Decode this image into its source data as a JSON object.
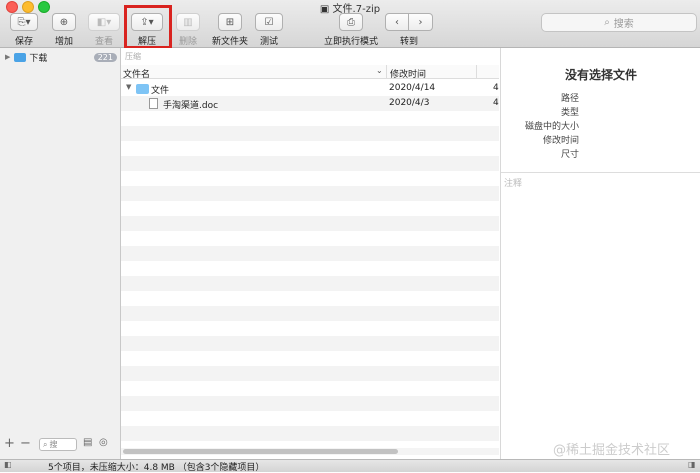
{
  "window": {
    "title": "文件.7-zip"
  },
  "toolbar": {
    "save": "保存",
    "add": "增加",
    "view": "查看",
    "extract": "解压",
    "delete": "删除",
    "new_folder": "新文件夹",
    "test": "测试",
    "run_mode": "立即执行模式",
    "goto": "转到",
    "search_placeholder": "搜索"
  },
  "sidebar": {
    "items": [
      {
        "label": "下载",
        "badge": "221"
      }
    ],
    "filter_placeholder": "搜"
  },
  "path_hint": "压缩",
  "table": {
    "columns": [
      "文件名",
      "修改时间"
    ],
    "rows": [
      {
        "name": "文件",
        "date": "2020/4/14",
        "extra": "4"
      },
      {
        "name": "手淘渠道.doc",
        "date": "2020/4/3",
        "extra": "4"
      }
    ]
  },
  "info": {
    "title": "没有选择文件",
    "fields": [
      "路径",
      "类型",
      "磁盘中的大小",
      "修改时间",
      "尺寸"
    ],
    "comment_placeholder": "注释"
  },
  "status": {
    "text": "5个项目，未压缩大小：4.8 MB （包含3个隐藏项目）"
  },
  "watermark": "@稀土掘金技术社区"
}
